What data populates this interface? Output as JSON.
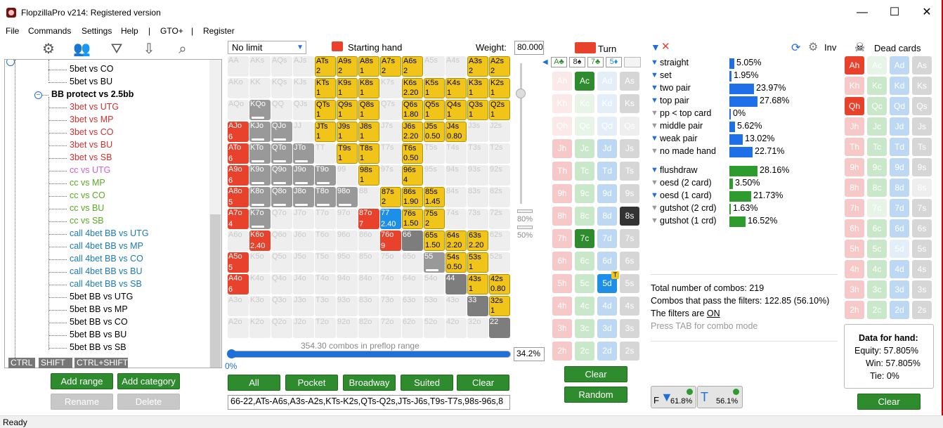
{
  "window": {
    "title": "FlopzillaPro v214: Registered version",
    "min": "—",
    "max": "☐",
    "close": "✕"
  },
  "menu": [
    "File",
    "Commands",
    "Settings",
    "Help",
    "|",
    "GTO+",
    "|",
    "Register"
  ],
  "status": "Ready",
  "tree": {
    "items": [
      {
        "label": "5bet vs CO",
        "color": "#000"
      },
      {
        "label": "5bet vs BU",
        "color": "#000"
      },
      {
        "label": "BB protect vs 2.5bb",
        "color": "#000",
        "group": true
      },
      {
        "label": "3bet vs UTG",
        "color": "#d03030"
      },
      {
        "label": "3bet vs MP",
        "color": "#d03030"
      },
      {
        "label": "3bet vs CO",
        "color": "#d03030"
      },
      {
        "label": "3bet vs BU",
        "color": "#d03030"
      },
      {
        "label": "3bet vs SB",
        "color": "#d03030"
      },
      {
        "label": "cc vs UTG",
        "color": "#d060d0"
      },
      {
        "label": "cc vs MP",
        "color": "#5aaa22"
      },
      {
        "label": "cc vs CO",
        "color": "#5aaa22"
      },
      {
        "label": "cc vs BU",
        "color": "#5aaa22"
      },
      {
        "label": "cc vs SB",
        "color": "#5aaa22"
      },
      {
        "label": "call 4bet BB vs UTG",
        "color": "#1a7ab8"
      },
      {
        "label": "call 4bet BB vs MP",
        "color": "#1a7ab8"
      },
      {
        "label": "call 4bet BB vs CO",
        "color": "#1a7ab8"
      },
      {
        "label": "call 4bet BB vs BU",
        "color": "#1a7ab8"
      },
      {
        "label": "call 4bet BB vs SB",
        "color": "#1a7ab8"
      },
      {
        "label": "5bet BB vs UTG",
        "color": "#000"
      },
      {
        "label": "5bet BB vs MP",
        "color": "#000"
      },
      {
        "label": "5bet BB vs CO",
        "color": "#000"
      },
      {
        "label": "5bet BB vs BU",
        "color": "#000"
      },
      {
        "label": "5bet BB vs SB",
        "color": "#000"
      }
    ],
    "ctrl": [
      "CTRL",
      "SHIFT",
      "CTRL+SHIFT"
    ],
    "buttons": {
      "add_range": "Add range",
      "add_category": "Add category",
      "rename": "Rename",
      "delete": "Delete"
    }
  },
  "range": {
    "limit": "No limit",
    "starting_hand": "Starting hand",
    "weight_label": "Weight:",
    "weight_value": "80.000",
    "slider_labels": [
      "80%",
      "50%"
    ],
    "combos_text": "354.30 combos in preflop range",
    "progress_left": "0%",
    "progress_value": "34.2%",
    "buttons": [
      "All",
      "Pocket",
      "Broadway",
      "Suited",
      "Clear"
    ],
    "range_text": "66-22,ATs-A6s,A3s-A2s,KTs-K2s,QTs-Q2s,JTs-J6s,T9s-T7s,98s-96s,8",
    "grid": [
      [
        [
          "AA",
          "e"
        ],
        [
          "AKs",
          "e"
        ],
        [
          "AQs",
          "e"
        ],
        [
          "AJs",
          "e"
        ],
        [
          "ATs",
          "y",
          "2"
        ],
        [
          "A9s",
          "y",
          "2"
        ],
        [
          "A8s",
          "y",
          "1"
        ],
        [
          "A7s",
          "y",
          "2"
        ],
        [
          "A6s",
          "y",
          "2"
        ],
        [
          "A5s",
          "e"
        ],
        [
          "A4s",
          "e"
        ],
        [
          "A3s",
          "y",
          "2"
        ],
        [
          "A2s",
          "y",
          "2"
        ]
      ],
      [
        [
          "AKo",
          "e"
        ],
        [
          "KK",
          "e"
        ],
        [
          "KQs",
          "e"
        ],
        [
          "KJs",
          "e"
        ],
        [
          "KTs",
          "y",
          "1"
        ],
        [
          "K9s",
          "y",
          "1"
        ],
        [
          "K8s",
          "y",
          "1"
        ],
        [
          "K7s",
          "e"
        ],
        [
          "K6s",
          "y",
          "2.20"
        ],
        [
          "K5s",
          "y",
          "1"
        ],
        [
          "K4s",
          "y",
          "1"
        ],
        [
          "K3s",
          "y",
          "1"
        ],
        [
          "K2s",
          "y",
          "1"
        ]
      ],
      [
        [
          "AQo",
          "e"
        ],
        [
          "KQo",
          "g"
        ],
        [
          "QQ",
          "e"
        ],
        [
          "QJs",
          "e"
        ],
        [
          "QTs",
          "y",
          "1"
        ],
        [
          "Q9s",
          "y",
          "1"
        ],
        [
          "Q8s",
          "y",
          "1"
        ],
        [
          "Q7s",
          "e"
        ],
        [
          "Q6s",
          "y",
          "1.80"
        ],
        [
          "Q5s",
          "y",
          "1"
        ],
        [
          "Q4s",
          "y",
          "1"
        ],
        [
          "Q3s",
          "y",
          "1"
        ],
        [
          "Q2s",
          "y",
          "1"
        ]
      ],
      [
        [
          "AJo",
          "r",
          "6"
        ],
        [
          "KJo",
          "g"
        ],
        [
          "QJo",
          "g"
        ],
        [
          "JJ",
          "e"
        ],
        [
          "JTs",
          "y",
          "1"
        ],
        [
          "J9s",
          "y",
          "1"
        ],
        [
          "J8s",
          "y",
          "1"
        ],
        [
          "J7s",
          "e"
        ],
        [
          "J6s",
          "y",
          "2.20"
        ],
        [
          "J5s",
          "y",
          "0.50"
        ],
        [
          "J4s",
          "y",
          "0.80"
        ],
        [
          "J3s",
          "e"
        ],
        [
          "J2s",
          "e"
        ]
      ],
      [
        [
          "ATo",
          "r",
          "6"
        ],
        [
          "KTo",
          "g"
        ],
        [
          "QTo",
          "g"
        ],
        [
          "JTo",
          "g"
        ],
        [
          "TT",
          "e"
        ],
        [
          "T9s",
          "y",
          "1"
        ],
        [
          "T8s",
          "y",
          "1"
        ],
        [
          "T7s",
          "e"
        ],
        [
          "T6s",
          "y",
          "0.50"
        ],
        [
          "T5s",
          "e"
        ],
        [
          "T4s",
          "e"
        ],
        [
          "T3s",
          "e"
        ],
        [
          "T2s",
          "e"
        ]
      ],
      [
        [
          "A9o",
          "r",
          "6"
        ],
        [
          "K9o",
          "g"
        ],
        [
          "Q9o",
          "g"
        ],
        [
          "J9o",
          "g"
        ],
        [
          "T9o",
          "g"
        ],
        [
          "99",
          "e"
        ],
        [
          "98s",
          "y",
          "1"
        ],
        [
          "97s",
          "e"
        ],
        [
          "96s",
          "y",
          "4"
        ],
        [
          "95s",
          "e"
        ],
        [
          "94s",
          "e"
        ],
        [
          "93s",
          "e"
        ],
        [
          "92s",
          "e"
        ]
      ],
      [
        [
          "A8o",
          "r",
          "5"
        ],
        [
          "K8o",
          "g"
        ],
        [
          "Q8o",
          "g"
        ],
        [
          "J8o",
          "g"
        ],
        [
          "T8o",
          "g"
        ],
        [
          "98o",
          "g"
        ],
        [
          "88",
          "e"
        ],
        [
          "87s",
          "y",
          "2"
        ],
        [
          "86s",
          "y",
          "1.90"
        ],
        [
          "85s",
          "y",
          "1.45"
        ],
        [
          "84s",
          "e"
        ],
        [
          "83s",
          "e"
        ],
        [
          "82s",
          "e"
        ]
      ],
      [
        [
          "A7o",
          "r",
          "4"
        ],
        [
          "K7o",
          "g"
        ],
        [
          "Q7o",
          "e"
        ],
        [
          "J7o",
          "e"
        ],
        [
          "T7o",
          "e"
        ],
        [
          "97o",
          "e"
        ],
        [
          "87o",
          "r",
          "7"
        ],
        [
          "77",
          "b",
          "2.40"
        ],
        [
          "76s",
          "y",
          "1.50"
        ],
        [
          "75s",
          "y",
          "2"
        ],
        [
          "74s",
          "e"
        ],
        [
          "73s",
          "e"
        ],
        [
          "72s",
          "e"
        ]
      ],
      [
        [
          "A6o",
          "e"
        ],
        [
          "K6o",
          "r",
          "2.40"
        ],
        [
          "Q6o",
          "e"
        ],
        [
          "J6o",
          "e"
        ],
        [
          "T6o",
          "e"
        ],
        [
          "96o",
          "e"
        ],
        [
          "86o",
          "e"
        ],
        [
          "76o",
          "r",
          "9"
        ],
        [
          "66",
          "dg"
        ],
        [
          "65s",
          "y",
          "1.50"
        ],
        [
          "64s",
          "y",
          "2.20"
        ],
        [
          "63s",
          "y",
          "2.20"
        ],
        [
          "62s",
          "e"
        ]
      ],
      [
        [
          "A5o",
          "r",
          "5"
        ],
        [
          "K5o",
          "e"
        ],
        [
          "Q5o",
          "e"
        ],
        [
          "J5o",
          "e"
        ],
        [
          "T5o",
          "e"
        ],
        [
          "95o",
          "e"
        ],
        [
          "85o",
          "e"
        ],
        [
          "75o",
          "e"
        ],
        [
          "65o",
          "e"
        ],
        [
          "55",
          "g"
        ],
        [
          "54s",
          "y",
          "0.50"
        ],
        [
          "53s",
          "y",
          "1"
        ],
        [
          "52s",
          "e"
        ]
      ],
      [
        [
          "A4o",
          "r",
          "6"
        ],
        [
          "K4o",
          "e"
        ],
        [
          "Q4o",
          "e"
        ],
        [
          "J4o",
          "e"
        ],
        [
          "T4o",
          "e"
        ],
        [
          "94o",
          "e"
        ],
        [
          "84o",
          "e"
        ],
        [
          "74o",
          "e"
        ],
        [
          "64o",
          "e"
        ],
        [
          "54o",
          "e"
        ],
        [
          "44",
          "dg"
        ],
        [
          "43s",
          "y",
          "1"
        ],
        [
          "42s",
          "y",
          "0.80"
        ]
      ],
      [
        [
          "A3o",
          "e"
        ],
        [
          "K3o",
          "e"
        ],
        [
          "Q3o",
          "e"
        ],
        [
          "J3o",
          "e"
        ],
        [
          "T3o",
          "e"
        ],
        [
          "93o",
          "e"
        ],
        [
          "83o",
          "e"
        ],
        [
          "73o",
          "e"
        ],
        [
          "63o",
          "e"
        ],
        [
          "53o",
          "e"
        ],
        [
          "43o",
          "e"
        ],
        [
          "33",
          "dg"
        ],
        [
          "32s",
          "y",
          "1"
        ]
      ],
      [
        [
          "A2o",
          "e"
        ],
        [
          "K2o",
          "e"
        ],
        [
          "Q2o",
          "e"
        ],
        [
          "J2o",
          "e"
        ],
        [
          "T2o",
          "e"
        ],
        [
          "92o",
          "e"
        ],
        [
          "82o",
          "e"
        ],
        [
          "72o",
          "e"
        ],
        [
          "62o",
          "e"
        ],
        [
          "52o",
          "e"
        ],
        [
          "42o",
          "e"
        ],
        [
          "32o",
          "e"
        ],
        [
          "22",
          "dg"
        ]
      ]
    ]
  },
  "board": {
    "turn_label": "Turn",
    "cards": [
      "A♣",
      "8♠",
      "7♣",
      "5♦"
    ],
    "rows": [
      "A",
      "K",
      "Q",
      "J",
      "T",
      "9",
      "8",
      "7",
      "6",
      "5",
      "4",
      "3",
      "2"
    ],
    "selected": {
      "Ac": "s",
      "8s": "s",
      "7c": "s",
      "5d": "s"
    },
    "disabled": [
      "Ah",
      "Qh",
      "Ad"
    ],
    "clear": "Clear",
    "random": "Random"
  },
  "filters": {
    "made": [
      {
        "label": "straight",
        "pct": "5.05%",
        "value": 5.05,
        "max": 27.68,
        "color": "#1e6fe8"
      },
      {
        "label": "set",
        "pct": "1.95%",
        "value": 1.95,
        "max": 27.68,
        "color": "#1e6fe8"
      },
      {
        "label": "two pair",
        "pct": "23.97%",
        "value": 23.97,
        "max": 27.68,
        "color": "#1e6fe8"
      },
      {
        "label": "top pair",
        "pct": "27.68%",
        "value": 27.68,
        "max": 27.68,
        "color": "#1e6fe8"
      },
      {
        "label": "pp < top card",
        "pct": "0%",
        "value": 0,
        "max": 27.68,
        "color": "#1e6fe8"
      },
      {
        "label": "middle pair",
        "pct": "5.62%",
        "value": 5.62,
        "max": 27.68,
        "color": "#1e6fe8"
      },
      {
        "label": "weak pair",
        "pct": "13.02%",
        "value": 13.02,
        "max": 27.68,
        "color": "#1e6fe8"
      },
      {
        "label": "no made hand",
        "pct": "22.71%",
        "value": 22.71,
        "max": 27.68,
        "color": "#1e6fe8"
      }
    ],
    "draws": [
      {
        "label": "flushdraw",
        "pct": "28.16%",
        "value": 28.16,
        "max": 28.16,
        "color": "#2e9b2e"
      },
      {
        "label": "oesd (2 card)",
        "pct": "3.50%",
        "value": 3.5,
        "max": 28.16,
        "color": "#2e9b2e"
      },
      {
        "label": "oesd (1 card)",
        "pct": "21.73%",
        "value": 21.73,
        "max": 28.16,
        "color": "#2e9b2e"
      },
      {
        "label": "gutshot (2 crd)",
        "pct": "1.63%",
        "value": 1.63,
        "max": 28.16,
        "color": "#2e9b2e"
      },
      {
        "label": "gutshot (1 crd)",
        "pct": "16.52%",
        "value": 16.52,
        "max": 28.16,
        "color": "#2e9b2e"
      }
    ],
    "total": "Total number of combos: 219",
    "passing": "Combos that pass the filters: 122.85 (56.10%)",
    "filters_are": "The filters are ",
    "filters_on": "ON",
    "tab_hint": "Press TAB for combo mode",
    "inv": "Inv",
    "f_badge": "61.8%",
    "t_badge": "56.1%"
  },
  "dead": {
    "label": "Dead cards",
    "selected": [
      "Ah",
      "Qh"
    ],
    "clear": "Clear",
    "data_title": "Data for hand:",
    "equity": "Equity: 57.805%",
    "win": "Win: 57.805%",
    "tie": "Tie: 0%"
  }
}
